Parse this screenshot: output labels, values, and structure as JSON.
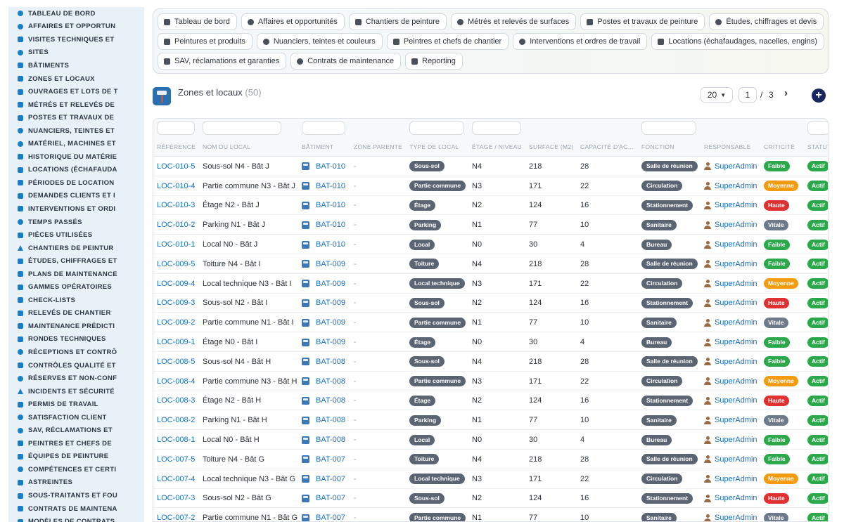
{
  "sidebar": {
    "items": [
      {
        "label": "Tableau de bord",
        "icon": "gauge-icon",
        "shape": "c"
      },
      {
        "label": "Affaires et opportun",
        "icon": "target-icon",
        "shape": "c"
      },
      {
        "label": "Visites techniques et",
        "icon": "clipboard-icon",
        "shape": "s"
      },
      {
        "label": "Sites",
        "icon": "location-pin-icon",
        "shape": "c"
      },
      {
        "label": "Bâtiments",
        "icon": "building-icon",
        "shape": "s"
      },
      {
        "label": "Zones et locaux",
        "icon": "grid-icon",
        "shape": "s"
      },
      {
        "label": "Ouvrages et lots de t",
        "icon": "sitemap-icon",
        "shape": "s"
      },
      {
        "label": "Métrés et relevés de",
        "icon": "ruler-icon",
        "shape": "s"
      },
      {
        "label": "Postes et travaux de",
        "icon": "paint-roller-icon",
        "shape": "s"
      },
      {
        "label": "Nuanciers, teintes et",
        "icon": "palette-icon",
        "shape": "c"
      },
      {
        "label": "Matériel, machines et",
        "icon": "cogs-icon",
        "shape": "c"
      },
      {
        "label": "Historique du matérie",
        "icon": "history-icon",
        "shape": "s"
      },
      {
        "label": "Locations (échafauda",
        "icon": "truck-icon",
        "shape": "s"
      },
      {
        "label": "Périodes de location",
        "icon": "calendar-icon",
        "shape": "s"
      },
      {
        "label": "Demandes clients et i",
        "icon": "inbox-icon",
        "shape": "s"
      },
      {
        "label": "Interventions et ordi",
        "icon": "tasks-icon",
        "shape": "s"
      },
      {
        "label": "Temps passés",
        "icon": "clock-icon",
        "shape": "c"
      },
      {
        "label": "Pièces utilisées",
        "icon": "cube-icon",
        "shape": "s"
      },
      {
        "label": "Chantiers de peintur",
        "icon": "brush-icon",
        "shape": "t"
      },
      {
        "label": "Études, chiffrages et",
        "icon": "calculator-icon",
        "shape": "s"
      },
      {
        "label": "Plans de maintenance",
        "icon": "calendar-check-icon",
        "shape": "s"
      },
      {
        "label": "Gammes opératoires",
        "icon": "list-icon",
        "shape": "s"
      },
      {
        "label": "Check-lists",
        "icon": "checklist-icon",
        "shape": "s"
      },
      {
        "label": "Relevés de chantier",
        "icon": "file-icon",
        "shape": "s"
      },
      {
        "label": "Maintenance prédicti",
        "icon": "chart-line-icon",
        "shape": "s"
      },
      {
        "label": "Rondes techniques",
        "icon": "route-icon",
        "shape": "s"
      },
      {
        "label": "Réceptions et contrô",
        "icon": "search-icon",
        "shape": "c"
      },
      {
        "label": "Contrôles qualité et",
        "icon": "clipboard-check-icon",
        "shape": "s"
      },
      {
        "label": "Réserves et non-conf",
        "icon": "alert-circle-icon",
        "shape": "c"
      },
      {
        "label": "Incidents et sécurité",
        "icon": "warning-icon",
        "shape": "t"
      },
      {
        "label": "Permis de travail",
        "icon": "permit-icon",
        "shape": "s"
      },
      {
        "label": "Satisfaction client",
        "icon": "smile-icon",
        "shape": "c"
      },
      {
        "label": "SAV, réclamations et",
        "icon": "comment-icon",
        "shape": "c"
      },
      {
        "label": "Peintres et chefs de",
        "icon": "hard-hat-icon",
        "shape": "s"
      },
      {
        "label": "Équipes de peinture",
        "icon": "users-icon",
        "shape": "s"
      },
      {
        "label": "Compétences et certi",
        "icon": "certificate-icon",
        "shape": "c"
      },
      {
        "label": "Astreintes",
        "icon": "phone-icon",
        "shape": "s"
      },
      {
        "label": "Sous-traitants et fou",
        "icon": "handshake-icon",
        "shape": "s"
      },
      {
        "label": "Contrats de maintena",
        "icon": "contract-icon",
        "shape": "s"
      },
      {
        "label": "Modèles de contrats",
        "icon": "template-icon",
        "shape": "s"
      }
    ]
  },
  "topnav": {
    "rows": [
      [
        {
          "label": "Tableau de bord",
          "icon": "gauge-icon"
        },
        {
          "label": "Affaires et opportunités",
          "icon": "target-icon"
        },
        {
          "label": "Chantiers de peinture",
          "icon": "brush-icon"
        },
        {
          "label": "Métrés et relevés de surfaces",
          "icon": "ruler-icon"
        },
        {
          "label": "Postes et travaux de peinture",
          "icon": "paint-roller-icon"
        },
        {
          "label": "Études, chiffrages et devis",
          "icon": "calculator-icon"
        }
      ],
      [
        {
          "label": "Peintures et produits",
          "icon": "fill-drip-icon"
        },
        {
          "label": "Nuanciers, teintes et couleurs",
          "icon": "palette-icon"
        },
        {
          "label": "Peintres et chefs de chantier",
          "icon": "hard-hat-icon"
        },
        {
          "label": "Interventions et ordres de travail",
          "icon": "tasks-icon"
        },
        {
          "label": "Locations (échafaudages, nacelles, engins)",
          "icon": "truck-icon"
        }
      ],
      [
        {
          "label": "SAV, réclamations et garanties",
          "icon": "comment-icon"
        },
        {
          "label": "Contrats de maintenance",
          "icon": "contract-icon"
        },
        {
          "label": "Reporting",
          "icon": "chart-pie-icon"
        }
      ]
    ]
  },
  "page": {
    "title": "Zones et locaux",
    "count": "(50)",
    "per_page": "20",
    "current_page": "1",
    "page_sep": "/",
    "total_pages": "3",
    "add_label": "+"
  },
  "table": {
    "columns": [
      "Référence",
      "Nom du local",
      "Bâtiment",
      "Zone parente",
      "Type de local",
      "Étage / Niveau",
      "Surface (m2)",
      "Capacité d'ac...",
      "Fonction",
      "Responsable",
      "Criticité",
      "Statut"
    ],
    "rows": [
      [
        "LOC-010-5",
        "Sous-sol N4 - Bât J",
        "BAT-010",
        "-",
        "Sous-sol",
        "N4",
        "218",
        "28",
        "Salle de réunion",
        "SuperAdmin",
        "Faible",
        "Actif"
      ],
      [
        "LOC-010-4",
        "Partie commune N3 - Bât J",
        "BAT-010",
        "-",
        "Partie commune",
        "N3",
        "171",
        "22",
        "Circulation",
        "SuperAdmin",
        "Moyenne",
        "Actif"
      ],
      [
        "LOC-010-3",
        "Étage N2 - Bât J",
        "BAT-010",
        "-",
        "Étage",
        "N2",
        "124",
        "16",
        "Stationnement",
        "SuperAdmin",
        "Haute",
        "Actif"
      ],
      [
        "LOC-010-2",
        "Parking N1 - Bât J",
        "BAT-010",
        "-",
        "Parking",
        "N1",
        "77",
        "10",
        "Sanitaire",
        "SuperAdmin",
        "Vitale",
        "Actif"
      ],
      [
        "LOC-010-1",
        "Local N0 - Bât J",
        "BAT-010",
        "-",
        "Local",
        "N0",
        "30",
        "4",
        "Bureau",
        "SuperAdmin",
        "Faible",
        "Actif"
      ],
      [
        "LOC-009-5",
        "Toiture N4 - Bât I",
        "BAT-009",
        "-",
        "Toiture",
        "N4",
        "218",
        "28",
        "Salle de réunion",
        "SuperAdmin",
        "Faible",
        "Actif"
      ],
      [
        "LOC-009-4",
        "Local technique N3 - Bât I",
        "BAT-009",
        "-",
        "Local technique",
        "N3",
        "171",
        "22",
        "Circulation",
        "SuperAdmin",
        "Moyenne",
        "Actif"
      ],
      [
        "LOC-009-3",
        "Sous-sol N2 - Bât I",
        "BAT-009",
        "-",
        "Sous-sol",
        "N2",
        "124",
        "16",
        "Stationnement",
        "SuperAdmin",
        "Haute",
        "Actif"
      ],
      [
        "LOC-009-2",
        "Partie commune N1 - Bât I",
        "BAT-009",
        "-",
        "Partie commune",
        "N1",
        "77",
        "10",
        "Sanitaire",
        "SuperAdmin",
        "Vitale",
        "Actif"
      ],
      [
        "LOC-009-1",
        "Étage N0 - Bât I",
        "BAT-009",
        "-",
        "Étage",
        "N0",
        "30",
        "4",
        "Bureau",
        "SuperAdmin",
        "Faible",
        "Actif"
      ],
      [
        "LOC-008-5",
        "Sous-sol N4 - Bât H",
        "BAT-008",
        "-",
        "Sous-sol",
        "N4",
        "218",
        "28",
        "Salle de réunion",
        "SuperAdmin",
        "Faible",
        "Actif"
      ],
      [
        "LOC-008-4",
        "Partie commune N3 - Bât H",
        "BAT-008",
        "-",
        "Partie commune",
        "N3",
        "171",
        "22",
        "Circulation",
        "SuperAdmin",
        "Moyenne",
        "Actif"
      ],
      [
        "LOC-008-3",
        "Étage N2 - Bât H",
        "BAT-008",
        "-",
        "Étage",
        "N2",
        "124",
        "16",
        "Stationnement",
        "SuperAdmin",
        "Haute",
        "Actif"
      ],
      [
        "LOC-008-2",
        "Parking N1 - Bât H",
        "BAT-008",
        "-",
        "Parking",
        "N1",
        "77",
        "10",
        "Sanitaire",
        "SuperAdmin",
        "Vitale",
        "Actif"
      ],
      [
        "LOC-008-1",
        "Local N0 - Bât H",
        "BAT-008",
        "-",
        "Local",
        "N0",
        "30",
        "4",
        "Bureau",
        "SuperAdmin",
        "Faible",
        "Actif"
      ],
      [
        "LOC-007-5",
        "Toiture N4 - Bât G",
        "BAT-007",
        "-",
        "Toiture",
        "N4",
        "218",
        "28",
        "Salle de réunion",
        "SuperAdmin",
        "Faible",
        "Actif"
      ],
      [
        "LOC-007-4",
        "Local technique N3 - Bât G",
        "BAT-007",
        "-",
        "Local technique",
        "N3",
        "171",
        "22",
        "Circulation",
        "SuperAdmin",
        "Moyenne",
        "Actif"
      ],
      [
        "LOC-007-3",
        "Sous-sol N2 - Bât G",
        "BAT-007",
        "-",
        "Sous-sol",
        "N2",
        "124",
        "16",
        "Stationnement",
        "SuperAdmin",
        "Haute",
        "Actif"
      ],
      [
        "LOC-007-2",
        "Partie commune N1 - Bât G",
        "BAT-007",
        "-",
        "Partie commune",
        "N1",
        "77",
        "10",
        "Sanitaire",
        "SuperAdmin",
        "Vitale",
        "Actif"
      ]
    ]
  },
  "colors": {
    "Faible": "#2ba84a",
    "Moyenne": "#f39c12",
    "Haute": "#e03131",
    "Vitale": "#6c7a89",
    "accent": "#1a6fbf",
    "tag": "#5b6472",
    "status": "#2ba84a"
  }
}
